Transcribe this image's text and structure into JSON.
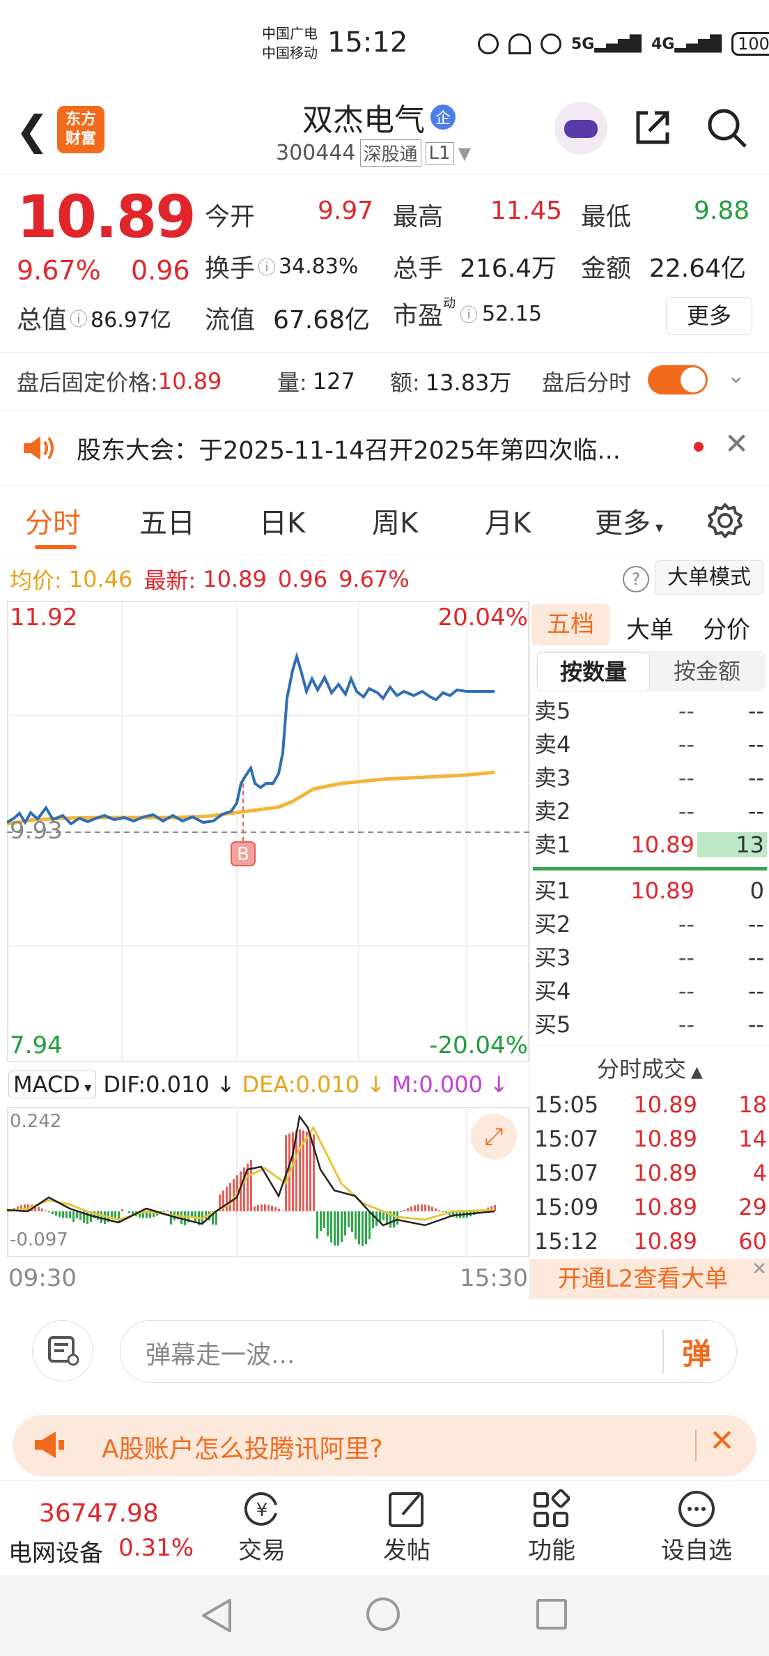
{
  "status": {
    "carrier1": "中国广电",
    "carrier2": "中国移动",
    "time": "15:12",
    "battery": "100",
    "net1": "5G",
    "net2": "4G"
  },
  "header": {
    "title": "双杰电气",
    "tag": "企",
    "code": "300444",
    "market": "深股通",
    "level": "L1",
    "logo_line1": "东方",
    "logo_line2": "财富"
  },
  "quote": {
    "price": "10.89",
    "pct": "9.67%",
    "chg": "0.96",
    "open_label": "今开",
    "open": "9.97",
    "high_label": "最高",
    "high": "11.45",
    "low_label": "最低",
    "low": "9.88",
    "turnover_label": "换手",
    "turnover": "34.83%",
    "volume_label": "总手",
    "volume": "216.4万",
    "amount_label": "金额",
    "amount": "22.64亿",
    "mktcap_label": "总值",
    "mktcap": "86.97亿",
    "float_label": "流值",
    "float": "67.68亿",
    "pe_label": "市盈",
    "pe_sup": "动",
    "pe": "52.15",
    "more": "更多"
  },
  "afterhours": {
    "label": "盘后固定价格:",
    "price": "10.89",
    "vol_label": "量:",
    "vol": "127",
    "amt_label": "额:",
    "amt": "13.83万",
    "toggle_label": "盘后分时"
  },
  "notice": {
    "text": "股东大会：于2025-11-14召开2025年第四次临..."
  },
  "tabs": [
    "分时",
    "五日",
    "日K",
    "周K",
    "月K",
    "更多"
  ],
  "summary": {
    "avg_label": "均价:",
    "avg": "10.46",
    "last_label": "最新:",
    "last": "10.89",
    "chg": "0.96",
    "pct": "9.67%",
    "mode": "大单模式"
  },
  "chart": {
    "ymax": "11.92",
    "ymax_pct": "20.04%",
    "ymin": "7.94",
    "ymin_pct": "-20.04%",
    "prev_close": "9.93",
    "marker": "B",
    "t_start": "09:30",
    "t_end": "15:30"
  },
  "macd": {
    "label": "MACD",
    "dif": "DIF:0.010",
    "dea": "DEA:0.010",
    "m": "M:0.000",
    "hi": "0.242",
    "lo": "-0.097"
  },
  "orderbook": {
    "tabs": [
      "五档",
      "大单",
      "分价"
    ],
    "subtabs": [
      "按数量",
      "按金额"
    ],
    "asks": [
      {
        "l": "卖5",
        "p": "--",
        "v": "--"
      },
      {
        "l": "卖4",
        "p": "--",
        "v": "--"
      },
      {
        "l": "卖3",
        "p": "--",
        "v": "--"
      },
      {
        "l": "卖2",
        "p": "--",
        "v": "--"
      },
      {
        "l": "卖1",
        "p": "10.89",
        "v": "13"
      }
    ],
    "bids": [
      {
        "l": "买1",
        "p": "10.89",
        "v": "0"
      },
      {
        "l": "买2",
        "p": "--",
        "v": "--"
      },
      {
        "l": "买3",
        "p": "--",
        "v": "--"
      },
      {
        "l": "买4",
        "p": "--",
        "v": "--"
      },
      {
        "l": "买5",
        "p": "--",
        "v": "--"
      }
    ],
    "trades_title": "分时成交",
    "trades": [
      {
        "t": "15:05",
        "p": "10.89",
        "v": "18"
      },
      {
        "t": "15:07",
        "p": "10.89",
        "v": "14"
      },
      {
        "t": "15:07",
        "p": "10.89",
        "v": "4"
      },
      {
        "t": "15:09",
        "p": "10.89",
        "v": "29"
      },
      {
        "t": "15:12",
        "p": "10.89",
        "v": "60"
      }
    ],
    "l2": "开通L2查看大单"
  },
  "danmu": {
    "placeholder": "弹幕走一波...",
    "btn": "弹"
  },
  "ad": {
    "text": "A股账户怎么投腾讯阿里?"
  },
  "bottom": {
    "index_value": "36747.98",
    "index_name": "电网设备",
    "index_pct": "0.31%",
    "items": [
      "交易",
      "发帖",
      "功能",
      "设自选"
    ]
  }
}
